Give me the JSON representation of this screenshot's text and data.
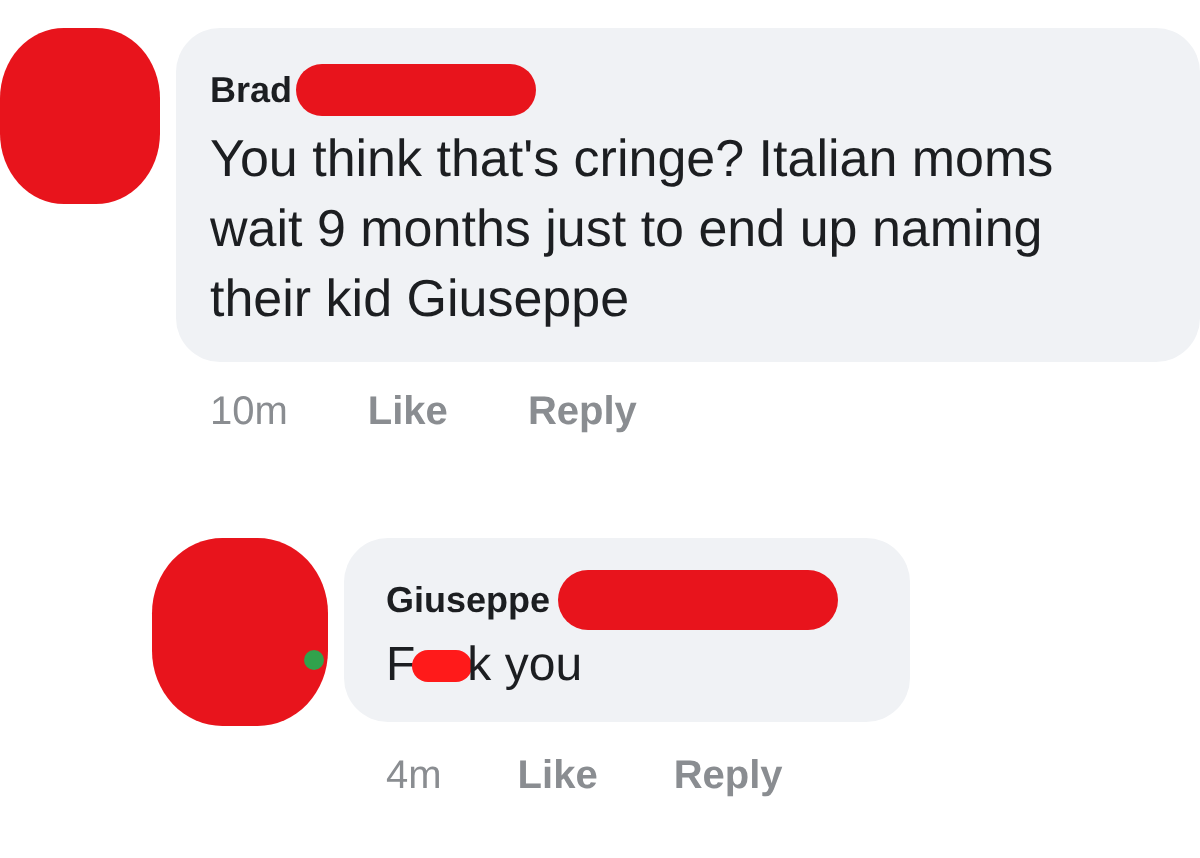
{
  "comments": [
    {
      "author": "Brad",
      "author_redacted": true,
      "online": false,
      "text_parts": [
        "You think that's cringe? Italian moms wait 9 months just to end up naming their kid Giuseppe"
      ],
      "time": "10m",
      "actions": [
        "Like",
        "Reply"
      ],
      "reply": false
    },
    {
      "author": "Giuseppe",
      "author_redacted": true,
      "online": true,
      "text_parts": [
        "F",
        "k you"
      ],
      "time": "4m",
      "actions": [
        "Like",
        "Reply"
      ],
      "reply": true
    }
  ]
}
